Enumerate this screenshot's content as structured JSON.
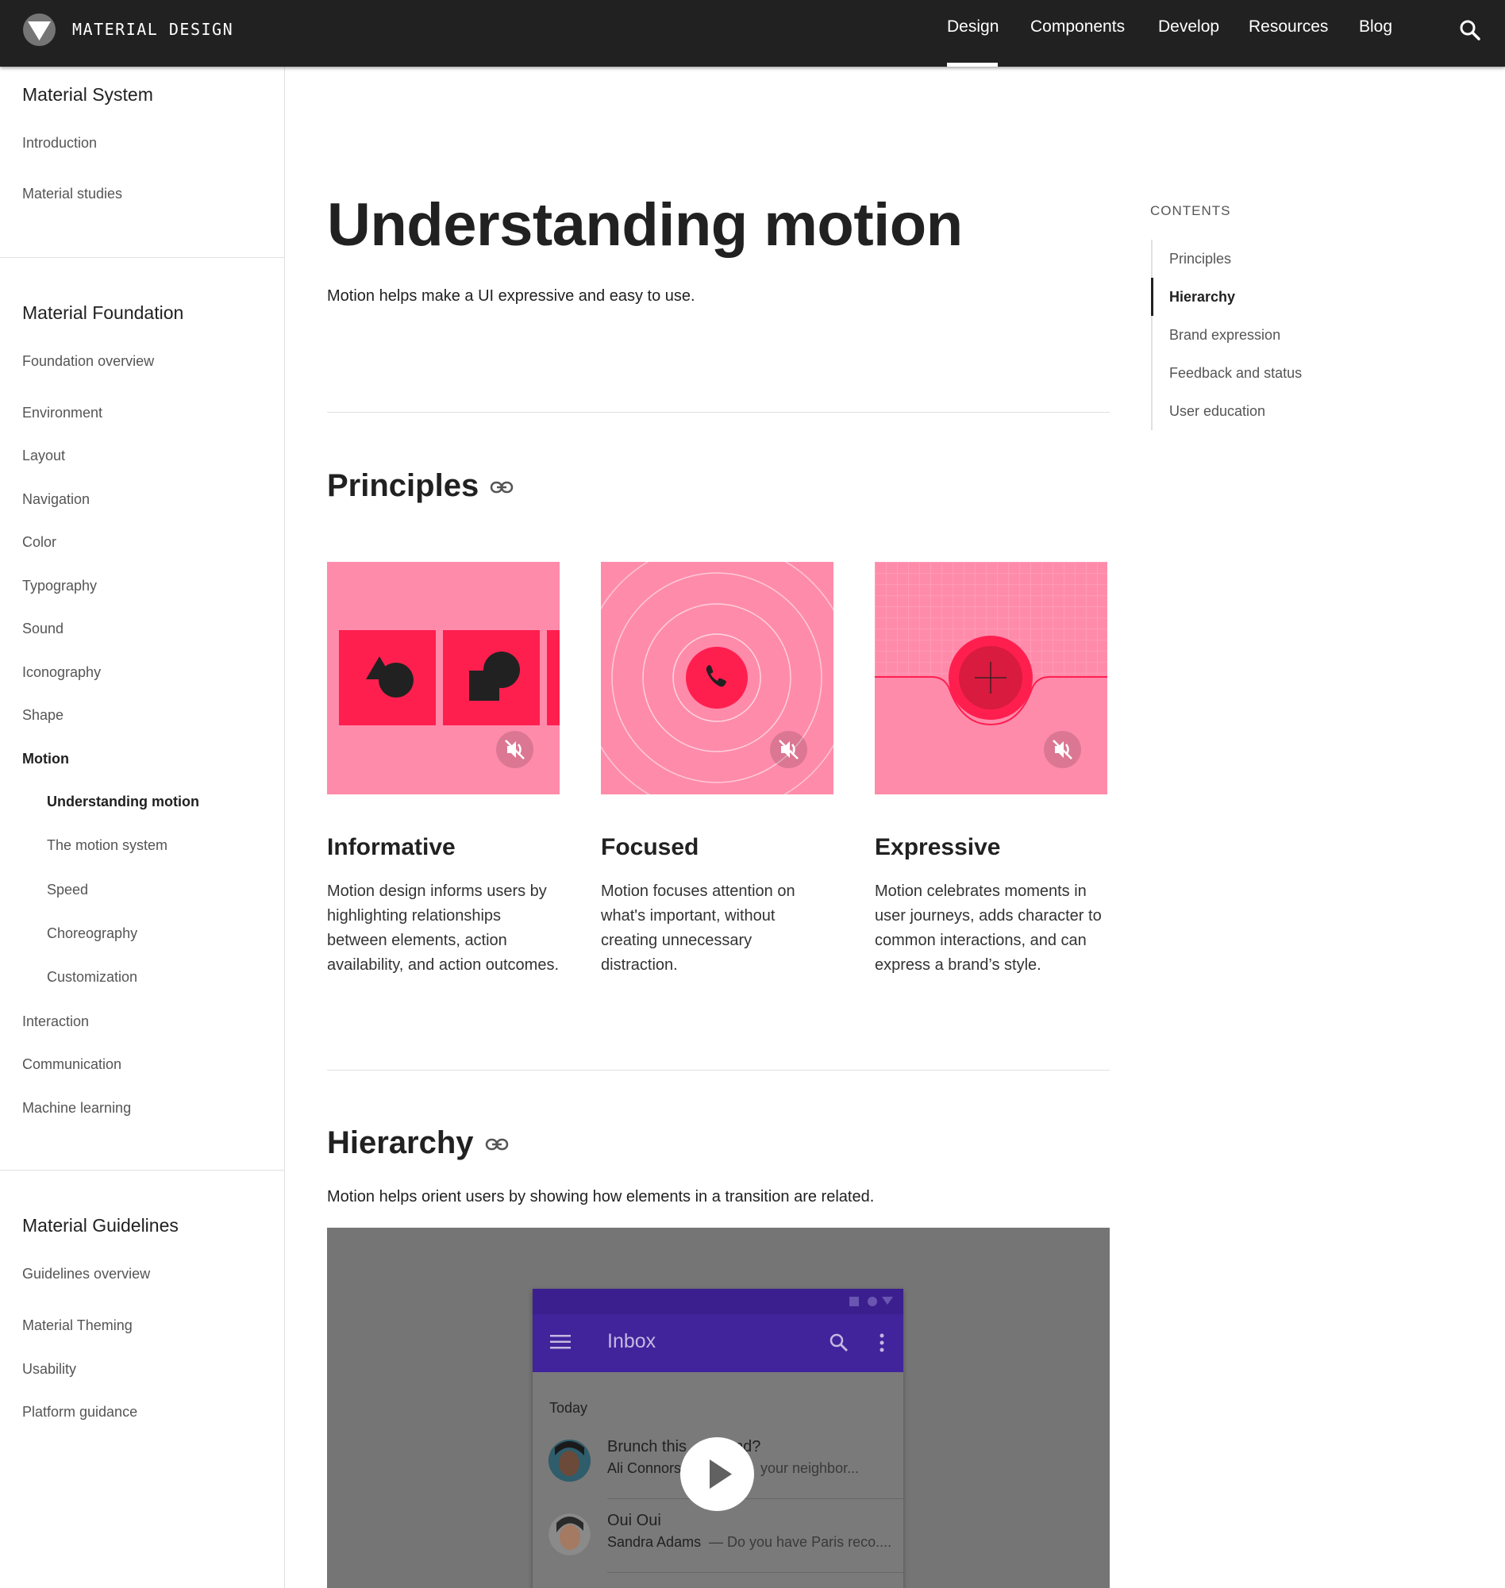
{
  "topbar": {
    "brand": "MATERIAL DESIGN",
    "nav": [
      "Design",
      "Components",
      "Develop",
      "Resources",
      "Blog"
    ],
    "active_nav": "Design",
    "search_icon": "search-icon"
  },
  "sidebar": {
    "system": {
      "heading": "Material System",
      "items": [
        "Introduction",
        "Material studies"
      ]
    },
    "foundation": {
      "heading": "Material Foundation",
      "items": [
        "Foundation overview",
        "Environment",
        "Layout",
        "Navigation",
        "Color",
        "Typography",
        "Sound",
        "Iconography",
        "Shape",
        "Motion"
      ],
      "motion_sub": [
        "Understanding motion",
        "The motion system",
        "Speed",
        "Choreography",
        "Customization"
      ],
      "items_after": [
        "Interaction",
        "Communication",
        "Machine learning"
      ]
    },
    "guidelines": {
      "heading": "Material Guidelines",
      "items": [
        "Guidelines overview",
        "Material Theming",
        "Usability",
        "Platform guidance"
      ]
    },
    "active_item": "Understanding motion"
  },
  "main": {
    "title": "Understanding motion",
    "lede": "Motion helps make a UI expressive and easy to use.",
    "principles": {
      "heading": "Principles",
      "cards": [
        {
          "title": "Informative",
          "text": "Motion design informs users by highlighting relationships between elements, action availability, and action outcomes."
        },
        {
          "title": "Focused",
          "text": "Motion focuses attention on what's important, without creating unnecessary distraction."
        },
        {
          "title": "Expressive",
          "text": "Motion celebrates moments in user journeys, adds character to common interactions, and can express a brand’s style."
        }
      ]
    },
    "hierarchy": {
      "heading": "Hierarchy",
      "text": "Motion helps orient users by showing how elements in a transition are related.",
      "video": {
        "app_title": "Inbox",
        "section": "Today",
        "mails": [
          {
            "subject": "Brunch this",
            "subject_tail": "nd?",
            "from": "Ali Connors",
            "snippet": "your neighbor..."
          },
          {
            "subject": "Oui Oui",
            "subject_tail": "",
            "from": "Sandra Adams",
            "snippet": "— Do you have Paris reco...."
          }
        ]
      }
    }
  },
  "contents": {
    "label": "CONTENTS",
    "items": [
      "Principles",
      "Hierarchy",
      "Brand expression",
      "Feedback and status",
      "User education"
    ],
    "active": "Hierarchy"
  },
  "colors": {
    "topbar": "#212121",
    "card_pink": "#ff8bab",
    "accent_red": "#ff1f4f",
    "inbox_purple": "#41239c"
  }
}
